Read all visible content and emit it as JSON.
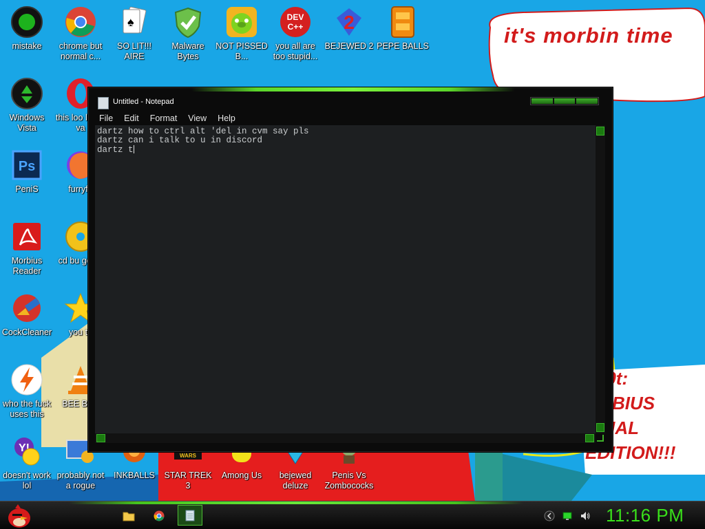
{
  "wallpaper": {
    "bubble_text": "it's morbin time",
    "overlay_text": "0b0t:\nORBIUS\nECIAL\nEDITION!!!"
  },
  "desktop_icons": [
    {
      "label": "mistake"
    },
    {
      "label": "chrome but normal c..."
    },
    {
      "label": "SO LIT!!! AIRE"
    },
    {
      "label": "Malware Bytes"
    },
    {
      "label": "NOT PISSED B..."
    },
    {
      "label": "you all are too stupid..."
    },
    {
      "label": "BEJEWED 2"
    },
    {
      "label": "PEPE BALLS"
    },
    {
      "label": "Windows Vista"
    },
    {
      "label": "this loo like a va"
    },
    {
      "label": "PeniS"
    },
    {
      "label": "furryfo"
    },
    {
      "label": "Morbius Reader"
    },
    {
      "label": "cd bu golde"
    },
    {
      "label": "CockCleaner"
    },
    {
      "label": "you tri"
    },
    {
      "label": "who the fuck uses this"
    },
    {
      "label": "BEE BEE"
    },
    {
      "label": "doesn't work lol"
    },
    {
      "label": "probably not a rogue"
    },
    {
      "label": "INKBALLS"
    },
    {
      "label": "STAR TREK 3"
    },
    {
      "label": "Among Us"
    },
    {
      "label": "bejewed deluze"
    },
    {
      "label": "Penis Vs Zombococks"
    }
  ],
  "notepad": {
    "title": "Untitled - Notepad",
    "menu": [
      "File",
      "Edit",
      "Format",
      "View",
      "Help"
    ],
    "content_lines": [
      "dartz how to ctrl alt 'del in cvm say pls",
      "dartz can i talk to u in discord",
      "dartz t"
    ]
  },
  "taskbar": {
    "clock": "11:16 PM"
  },
  "colors": {
    "desktop_bg": "#19a6e6",
    "accent_green": "#46c41e",
    "clock_green": "#39e01a",
    "bubble_red": "#d21b1b"
  }
}
